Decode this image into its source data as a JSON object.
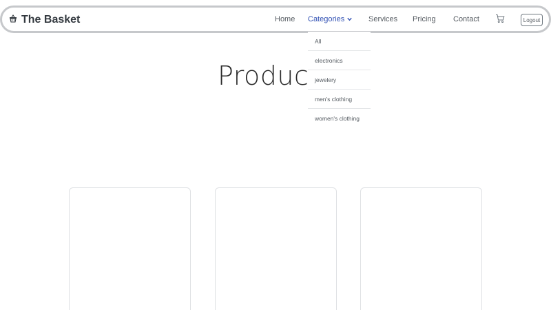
{
  "brand": {
    "name": "The Basket",
    "icon": "basket-icon"
  },
  "nav": {
    "home": "Home",
    "categories": "Categories",
    "services": "Services",
    "pricing": "Pricing",
    "contact": "Contact",
    "cart_icon": "cart-icon",
    "logout": "Logout"
  },
  "categories_menu": {
    "items": [
      "All",
      "electronics",
      "jewelery",
      "men's clothing",
      "women's clothing"
    ]
  },
  "main": {
    "title": "Products"
  },
  "colors": {
    "active_link": "#2f4fb3",
    "nav_border": "#c6c8cb",
    "text": "#343a40"
  }
}
